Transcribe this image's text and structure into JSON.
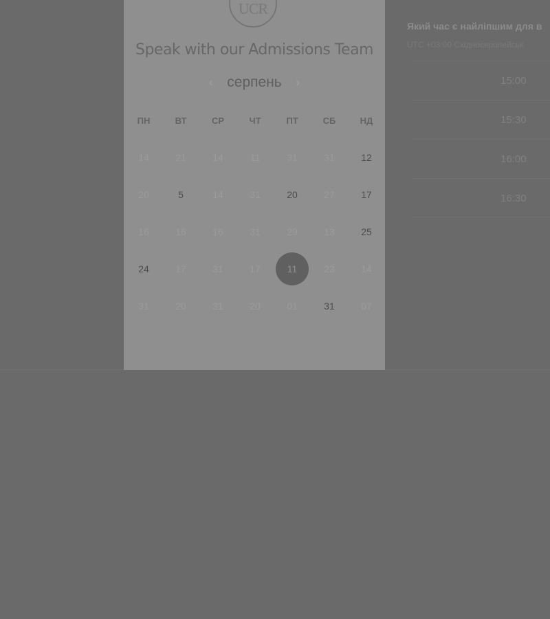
{
  "logo": {
    "text": "UCR"
  },
  "heading": "Speak with our Admissions Team",
  "calendar": {
    "month": "серпень",
    "prev_icon": "chevron-left-icon",
    "next_icon": "chevron-right-icon",
    "weekdays": [
      "ПН",
      "ВТ",
      "СР",
      "ЧТ",
      "ПТ",
      "СБ",
      "НД"
    ],
    "weeks": [
      [
        {
          "d": "14"
        },
        {
          "d": "21"
        },
        {
          "d": "14"
        },
        {
          "d": "11"
        },
        {
          "d": "31"
        },
        {
          "d": "31"
        },
        {
          "d": "12",
          "available": true
        }
      ],
      [
        {
          "d": "20"
        },
        {
          "d": "5",
          "available": true
        },
        {
          "d": "14"
        },
        {
          "d": "31"
        },
        {
          "d": "20",
          "available": true
        },
        {
          "d": "27"
        },
        {
          "d": "17",
          "available": true
        }
      ],
      [
        {
          "d": "16"
        },
        {
          "d": "16"
        },
        {
          "d": "16"
        },
        {
          "d": "31"
        },
        {
          "d": "29"
        },
        {
          "d": "13"
        },
        {
          "d": "25",
          "available": true
        }
      ],
      [
        {
          "d": "24",
          "available": true
        },
        {
          "d": "17"
        },
        {
          "d": "31"
        },
        {
          "d": "17"
        },
        {
          "d": "11",
          "selected": true
        },
        {
          "d": "23"
        },
        {
          "d": "14"
        }
      ],
      [
        {
          "d": "31"
        },
        {
          "d": "20"
        },
        {
          "d": "31"
        },
        {
          "d": "20"
        },
        {
          "d": "01"
        },
        {
          "d": "31",
          "available": true
        },
        {
          "d": "07"
        }
      ]
    ]
  },
  "times": {
    "title": "Який час є найліпшим для в",
    "timezone": "UTC +03:00 Східноєвропейськ",
    "slots": [
      "15:00",
      "15:30",
      "16:00",
      "16:30"
    ]
  }
}
